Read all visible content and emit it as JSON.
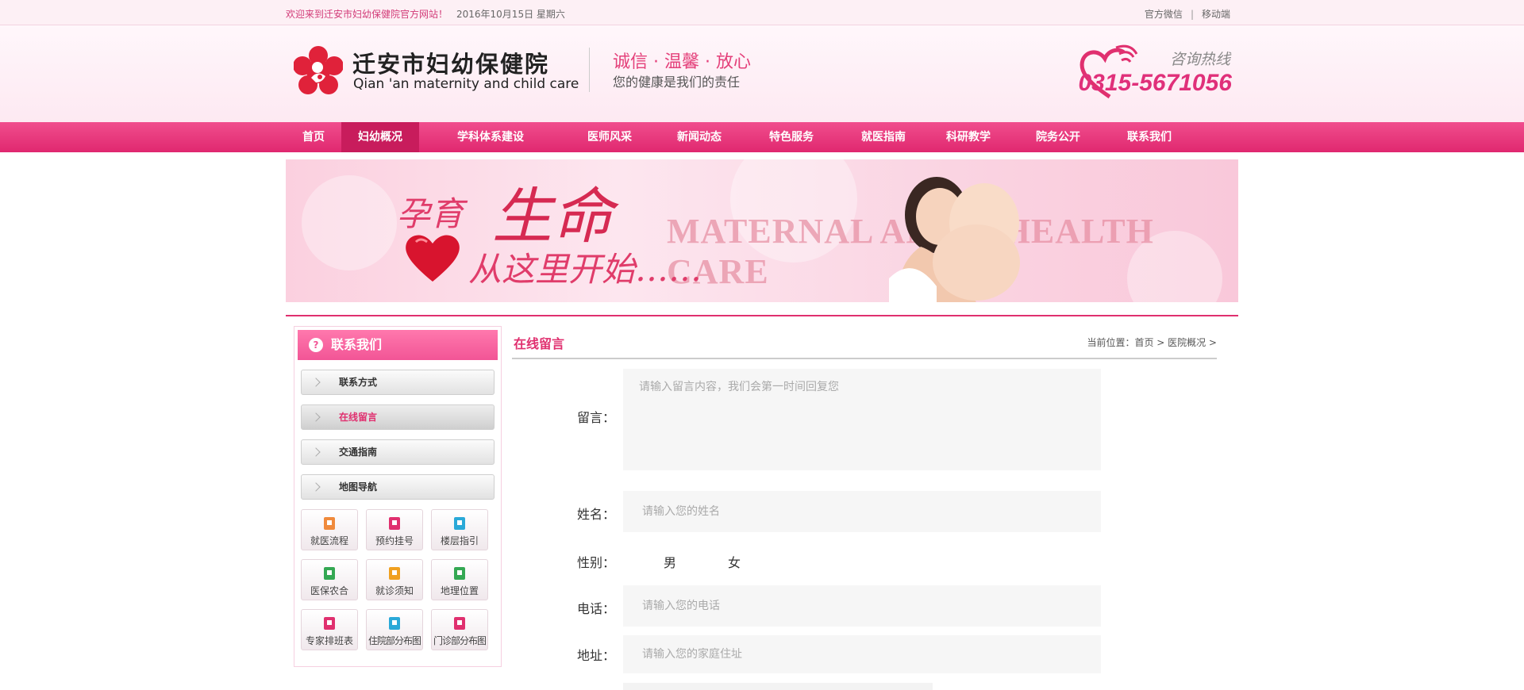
{
  "topbar": {
    "welcome": "欢迎来到迁安市妇幼保健院官方网站！",
    "date": "2016年10月15日  星期六",
    "link_wechat": "官方微信",
    "separator": "|",
    "link_mobile": "移动端"
  },
  "header": {
    "brand_cn": "迁安市妇幼保健院",
    "brand_en": "Qian 'an maternity and child care",
    "slogan": "诚信 · 温馨 · 放心",
    "subslogan": "您的健康是我们的责任",
    "hotline_label": "咨询热线",
    "hotline": "0315-5671056"
  },
  "nav": {
    "items": [
      "首页",
      "妇幼概况",
      "学科体系建设",
      "医师风采",
      "新闻动态",
      "特色服务",
      "就医指南",
      "科研教学",
      "院务公开",
      "联系我们"
    ],
    "active_index": 1
  },
  "banner": {
    "line1": "孕育",
    "line1_big": "生命",
    "line2": "从这里开始……",
    "english": "MATERNAL AND      D HEALTH CARE"
  },
  "sidebar": {
    "title": "联系我们",
    "menu": [
      "联系方式",
      "在线留言",
      "交通指南",
      "地图导航"
    ],
    "active_menu": 1,
    "tiles": [
      "就医流程",
      "预约挂号",
      "楼层指引",
      "医保农合",
      "就诊须知",
      "地理位置",
      "专家排班表",
      "住院部分布图",
      "门诊部分布图"
    ]
  },
  "main": {
    "title": "在线留言",
    "breadcrumb": "当前位置：首页 > 医院概况 >",
    "form": {
      "message_label": "留言：",
      "message_placeholder": "请输入留言内容，我们会第一时间回复您",
      "name_label": "姓名：",
      "name_placeholder": "请输入您的姓名",
      "gender_label": "性别：",
      "gender_male": "男",
      "gender_female": "女",
      "phone_label": "电话：",
      "phone_placeholder": "请输入您的电话",
      "address_label": "地址：",
      "address_placeholder": "请输入您的家庭住址"
    }
  },
  "colors": {
    "brand_pink": "#e0306f",
    "nav_active": "#c81c5c",
    "sidebar_title": "#f25596"
  }
}
